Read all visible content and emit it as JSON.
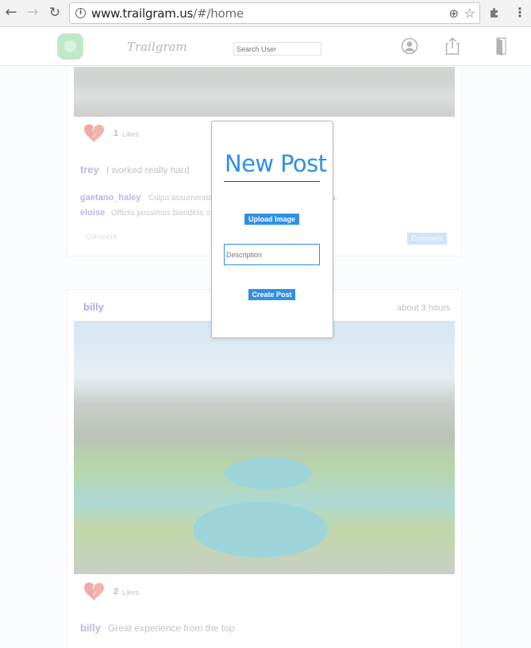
{
  "browser": {
    "url_host": "www.trailgram.us",
    "url_path": "/#/home",
    "icons": [
      "back-arrow",
      "forward-arrow",
      "reload",
      "info",
      "zoom",
      "star",
      "extension-puzzle",
      "menu-dots"
    ]
  },
  "app": {
    "brand": "Trailgram",
    "search_placeholder": "Search User",
    "icons": [
      "logo-camera",
      "profile",
      "share-upload",
      "logout-door"
    ]
  },
  "posts": [
    {
      "likes_count": "1",
      "likes_label": "Likes",
      "caption_user": "trey",
      "caption_text": "I worked really hard",
      "comments": [
        {
          "user": "gaetano_haley",
          "text": "Culpa assumenda",
          "tail": "a."
        },
        {
          "user": "eloise",
          "text": "Officiis possimus blanditiis c"
        }
      ],
      "comment_placeholder": "Comment",
      "comment_button": "Comment"
    },
    {
      "user": "billy",
      "time": "about 3 hours",
      "likes_count": "2",
      "likes_label": "Likes",
      "caption_user": "billy",
      "caption_text": "Great experience from the top"
    }
  ],
  "modal": {
    "title": "New Post",
    "upload_label": "Upload Image",
    "description_placeholder": "Description",
    "create_label": "Create Post"
  },
  "colors": {
    "accent": "#2f8fe6",
    "username": "#b4a9e6",
    "logo": "#bfe8c7"
  }
}
